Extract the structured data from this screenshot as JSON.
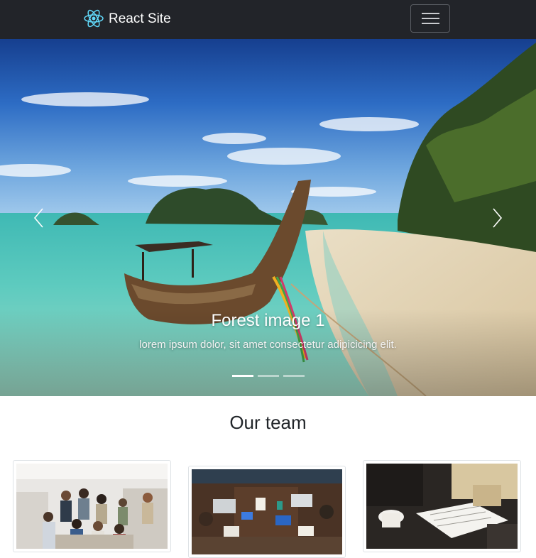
{
  "navbar": {
    "brand": "React Site",
    "logo_icon": "react-atom-icon",
    "toggler_icon": "hamburger-menu-icon",
    "background": "#222429"
  },
  "carousel": {
    "slides": [
      {
        "title": "Forest image 1",
        "text": "lorem ipsum dolor, sit amet consectetur adipicicing elit."
      }
    ],
    "indicators": 3,
    "active_index": 0,
    "prev_icon": "chevron-left-icon",
    "next_icon": "chevron-right-icon"
  },
  "team": {
    "title": "Our team",
    "cards": [
      {
        "icon": "team-photo-office-group"
      },
      {
        "icon": "team-photo-desk-laptops"
      },
      {
        "icon": "team-photo-meeting-notes"
      }
    ]
  }
}
